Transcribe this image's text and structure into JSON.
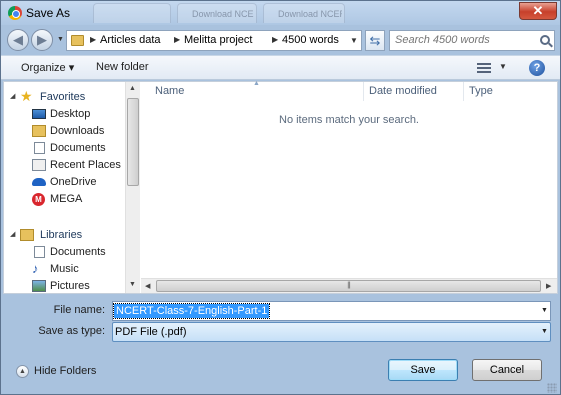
{
  "window": {
    "title": "Save As",
    "close_glyph": "✕"
  },
  "background_tabs": [
    "Download NCERT English",
    "Download NCERT books"
  ],
  "nav": {
    "breadcrumb": [
      "Articles data",
      "Melitta project",
      "4500 words"
    ],
    "search_placeholder": "Search 4500 words"
  },
  "toolbar": {
    "organize": "Organize ▾",
    "new_folder": "New folder",
    "help": "?"
  },
  "sidebar": {
    "favorites_header": "Favorites",
    "favorites": [
      {
        "label": "Desktop",
        "icon": "desktop-icon"
      },
      {
        "label": "Downloads",
        "icon": "downloads-folder-icon"
      },
      {
        "label": "Documents",
        "icon": "documents-icon"
      },
      {
        "label": "Recent Places",
        "icon": "recent-places-icon"
      },
      {
        "label": "OneDrive",
        "icon": "onedrive-cloud-icon"
      },
      {
        "label": "MEGA",
        "icon": "mega-icon"
      }
    ],
    "libraries_header": "Libraries",
    "libraries": [
      {
        "label": "Documents",
        "icon": "documents-icon"
      },
      {
        "label": "Music",
        "icon": "music-icon"
      },
      {
        "label": "Pictures",
        "icon": "pictures-icon"
      }
    ]
  },
  "file_list": {
    "columns": [
      "Name",
      "Date modified",
      "Type"
    ],
    "empty_message": "No items match your search."
  },
  "form": {
    "file_name_label": "File name:",
    "file_name_value": "NCERT-Class-7-English-Part-1",
    "save_type_label": "Save as type:",
    "save_type_value": "PDF File (.pdf)"
  },
  "footer": {
    "hide_folders": "Hide Folders",
    "save": "Save",
    "cancel": "Cancel"
  }
}
